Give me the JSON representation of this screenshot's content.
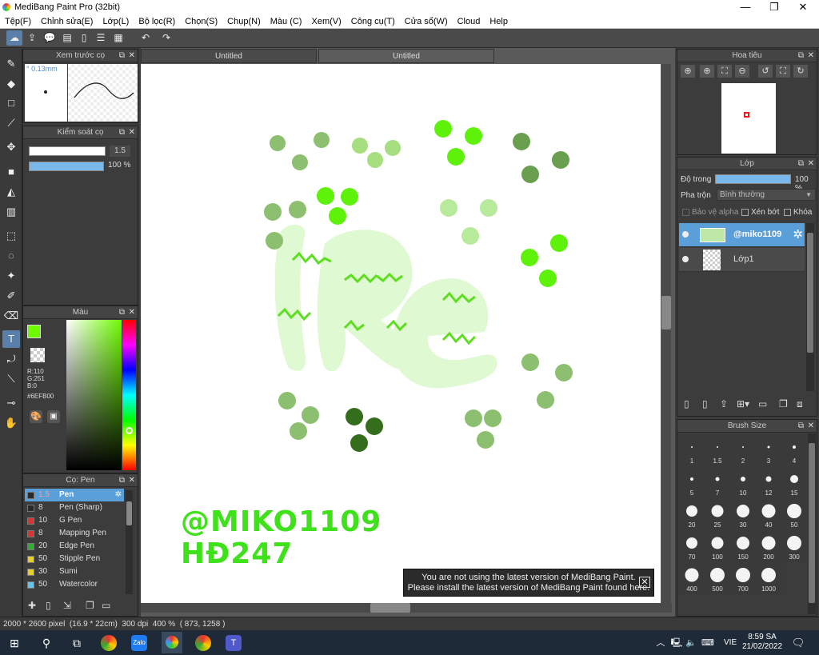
{
  "window": {
    "title": "MediBang Paint Pro (32bit)",
    "minimize": "—",
    "maximize": "❐",
    "close": "✕"
  },
  "menu": [
    "Tệp(F)",
    "Chỉnh sửa(E)",
    "Lớp(L)",
    "Bộ lọc(R)",
    "Chọn(S)",
    "Chụp(N)",
    "Màu (C)",
    "Xem(V)",
    "Công cụ(T)",
    "Cửa sổ(W)",
    "Cloud",
    "Help"
  ],
  "tabs": [
    {
      "label": "Untitled"
    },
    {
      "label": "Untitled"
    }
  ],
  "brush_preview": {
    "title": "Xem trước cọ",
    "size": "° 0.13mm"
  },
  "brush_control": {
    "title": "Kiểm soát cọ",
    "size_value": "1.5",
    "opacity_value": "100 %"
  },
  "color_panel": {
    "title": "Màu",
    "rgb": "R:110\nG:251\nB:0",
    "hex": "#6EFB00",
    "fg": "#6efb00"
  },
  "brush_list": {
    "title": "Cọ: Pen",
    "items": [
      {
        "size": "1.5",
        "name": "Pen",
        "color": "#2a2a2a",
        "selected": true
      },
      {
        "size": "8",
        "name": "Pen (Sharp)",
        "color": "#2a2a2a"
      },
      {
        "size": "10",
        "name": "G Pen",
        "color": "#e03030"
      },
      {
        "size": "8",
        "name": "Mapping Pen",
        "color": "#e03030"
      },
      {
        "size": "20",
        "name": "Edge Pen",
        "color": "#30b030"
      },
      {
        "size": "50",
        "name": "Stipple Pen",
        "color": "#e8d020"
      },
      {
        "size": "30",
        "name": "Sumi",
        "color": "#e8d020"
      },
      {
        "size": "50",
        "name": "Watercolor",
        "color": "#60c8f0"
      }
    ]
  },
  "navigator": {
    "title": "Hoa tiêu"
  },
  "layers": {
    "title": "Lớp",
    "opacity_label": "Độ trong",
    "opacity_value": "100 %",
    "blend_label": "Pha trộn",
    "blend_value": "Bình thường",
    "protect_alpha": "Bảo vệ alpha",
    "clipping": "Xén bớt",
    "lock": "Khóa",
    "items": [
      {
        "name": "@miko1109",
        "selected": true
      },
      {
        "name": "Lớp1",
        "selected": false
      }
    ]
  },
  "brush_size": {
    "title": "Brush Size",
    "sizes": [
      "1",
      "1.5",
      "2",
      "3",
      "4",
      "5",
      "7",
      "10",
      "12",
      "15",
      "20",
      "25",
      "30",
      "40",
      "50",
      "70",
      "100",
      "150",
      "200",
      "300",
      "400",
      "500",
      "700",
      "1000"
    ]
  },
  "canvas_text": {
    "line1": "@MIKO1109",
    "line2": "HĐ247"
  },
  "toast": {
    "line1": "You are not using the latest version of MediBang Paint.",
    "line2": "Please install the latest version of MediBang Paint found here."
  },
  "status": {
    "text": "2000 * 2600 pixel  (16.9 * 22cm)  300 dpi  400 %  ( 873, 1258 )"
  },
  "taskbar": {
    "lang": "VIE",
    "time": "8:59 SA",
    "date": "21/02/2022"
  }
}
